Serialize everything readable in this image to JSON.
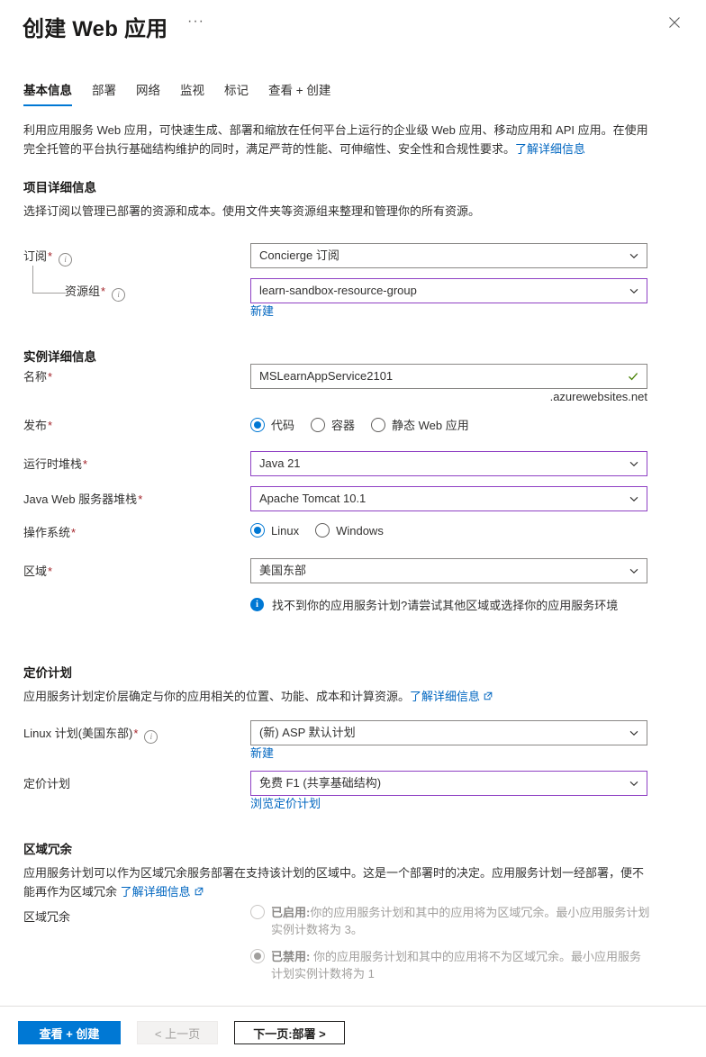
{
  "header": {
    "title": "创建 Web 应用",
    "ellipsis": "···",
    "close_icon": "close-icon"
  },
  "tabs": [
    {
      "label": "基本信息",
      "active": true
    },
    {
      "label": "部署",
      "active": false
    },
    {
      "label": "网络",
      "active": false
    },
    {
      "label": "监视",
      "active": false
    },
    {
      "label": "标记",
      "active": false
    },
    {
      "label": "查看 + 创建",
      "active": false
    }
  ],
  "intro": {
    "text": "利用应用服务 Web 应用，可快速生成、部署和缩放在任何平台上运行的企业级 Web 应用、移动应用和 API 应用。在使用完全托管的平台执行基础结构维护的同时，满足严苛的性能、可伸缩性、安全性和合规性要求。",
    "link": "了解详细信息"
  },
  "project_details": {
    "title": "项目详细信息",
    "description": "选择订阅以管理已部署的资源和成本。使用文件夹等资源组来整理和管理你的所有资源。",
    "subscription": {
      "label": "订阅",
      "required": "*",
      "value": "Concierge 订阅"
    },
    "resource_group": {
      "label": "资源组",
      "required": "*",
      "value": "learn-sandbox-resource-group",
      "new_link": "新建"
    }
  },
  "instance_details": {
    "title": "实例详细信息",
    "name": {
      "label": "名称",
      "required": "*",
      "value": "MSLearnAppService2101",
      "suffix": ".azurewebsites.net"
    },
    "publish": {
      "label": "发布",
      "required": "*",
      "options": [
        {
          "label": "代码",
          "selected": true
        },
        {
          "label": "容器",
          "selected": false
        },
        {
          "label": "静态 Web 应用",
          "selected": false
        }
      ]
    },
    "runtime_stack": {
      "label": "运行时堆栈",
      "required": "*",
      "value": "Java 21"
    },
    "java_web_server_stack": {
      "label": "Java Web 服务器堆栈",
      "required": "*",
      "value": "Apache Tomcat 10.1"
    },
    "operating_system": {
      "label": "操作系统",
      "required": "*",
      "options": [
        {
          "label": "Linux",
          "selected": true
        },
        {
          "label": "Windows",
          "selected": false
        }
      ]
    },
    "region": {
      "label": "区域",
      "required": "*",
      "value": "美国东部"
    },
    "region_info": "找不到你的应用服务计划?请尝试其他区域或选择你的应用服务环境"
  },
  "pricing_plan": {
    "title": "定价计划",
    "description": "应用服务计划定价层确定与你的应用相关的位置、功能、成本和计算资源。",
    "description_link": "了解详细信息",
    "linux_plan": {
      "label": "Linux 计划(美国东部)",
      "required": "*",
      "value": "(新) ASP 默认计划",
      "new_link": "新建"
    },
    "pricing_tier": {
      "label": "定价计划",
      "value": "免费 F1 (共享基础结构)",
      "browse_link": "浏览定价计划"
    }
  },
  "zone_redundancy": {
    "title": "区域冗余",
    "description": "应用服务计划可以作为区域冗余服务部署在支持该计划的区域中。这是一个部署时的决定。应用服务计划一经部署，便不能再作为区域冗余",
    "description_link": "了解详细信息",
    "field_label": "区域冗余",
    "options": [
      {
        "prefix": "已启用:",
        "text": "你的应用服务计划和其中的应用将为区域冗余。最小应用服务计划实例计数将为 3。",
        "selected": false,
        "disabled": true
      },
      {
        "prefix": "已禁用:",
        "text": " 你的应用服务计划和其中的应用将不为区域冗余。最小应用服务计划实例计数将为 1",
        "selected": true,
        "disabled": true
      }
    ]
  },
  "footer": {
    "review_create": "查看 + 创建",
    "previous": "< 上一页",
    "next": "下一页:部署  >"
  },
  "colors": {
    "accent": "#0078d4",
    "link": "#0066c0",
    "required": "#a4262c",
    "focus_border": "#8f41c4",
    "valid_check": "#498205",
    "disabled_text": "#a19f9d"
  }
}
